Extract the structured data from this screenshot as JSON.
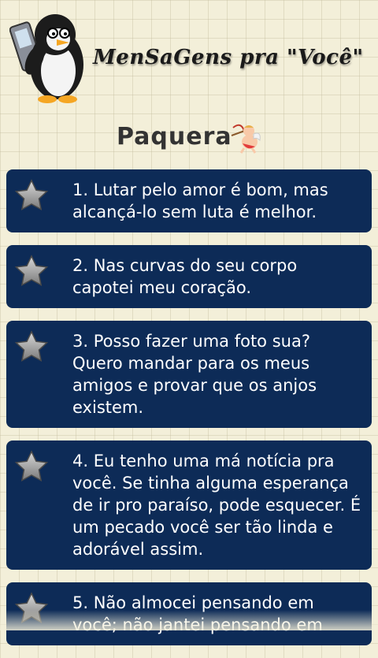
{
  "app": {
    "title": "MenSaGens pra \"Você\"",
    "mascot_icon": "penguin-with-phone-icon"
  },
  "section": {
    "title": "Paquera",
    "icon": "cupid-icon"
  },
  "colors": {
    "card_background": "#0d2b57",
    "card_text": "#ffffff",
    "page_background": "#f3efd9",
    "section_title": "#333333"
  },
  "messages": [
    {
      "text": "1. Lutar pelo amor é bom, mas alcançá-lo sem luta é melhor.",
      "icon": "star-icon"
    },
    {
      "text": "2. Nas curvas do seu corpo capotei meu coração.",
      "icon": "star-icon"
    },
    {
      "text": "3. Posso fazer uma foto sua? Quero mandar para os meus amigos e provar que os anjos existem.",
      "icon": "star-icon"
    },
    {
      "text": "4. Eu tenho uma má notícia pra você. Se tinha alguma esperança de ir pro paraíso, pode esquecer. É um pecado você ser tão linda e adorável assim.",
      "icon": "star-icon"
    },
    {
      "text": "5. Não almocei pensando em você; não jantei pensando em",
      "icon": "star-icon"
    }
  ]
}
